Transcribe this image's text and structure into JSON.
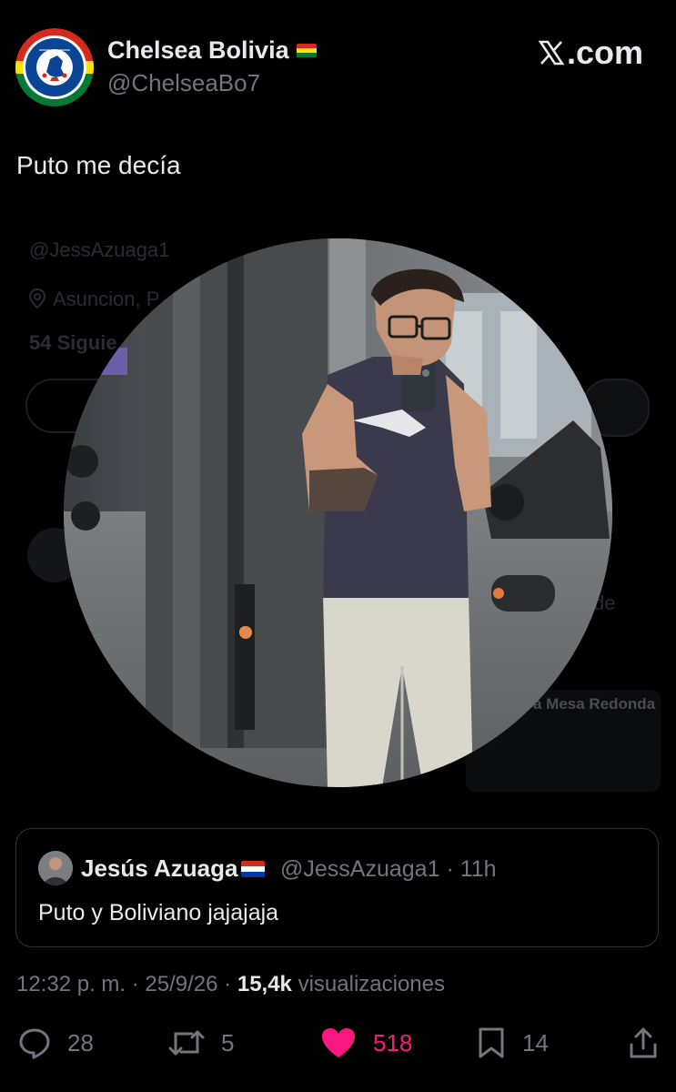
{
  "author": {
    "name": "Chelsea Bolivia",
    "handle": "@ChelseaBo7",
    "avatar_icon": "chelsea-fc-crest-icon",
    "flag": "bolivia-flag-icon"
  },
  "brand": {
    "site": ".com",
    "logo_icon": "x-logo-icon"
  },
  "tweet": {
    "text": "Puto me decía"
  },
  "media": {
    "background_profile_text": {
      "handle": "@JessAzuaga1",
      "location": "Asuncion, P",
      "following": "54 Siguie",
      "community": "a Mesa Redonda",
      "community_sub": "de"
    }
  },
  "quote": {
    "name": "Jesús Azuaga",
    "flag": "paraguay-flag-icon",
    "handle": "@JessAzuaga1",
    "time": "· 11h",
    "text": "Puto y Boliviano jajajaja"
  },
  "meta": {
    "time": "12:32 p. m.",
    "sep1": "·",
    "date": "25/9/26",
    "sep2": "·",
    "views": "15,4k",
    "views_label": "visualizaciones"
  },
  "actions": {
    "replies": "28",
    "reposts": "5",
    "likes": "518",
    "bookmarks": "14"
  },
  "colors": {
    "background": "#000000",
    "text": "#e7e9ea",
    "muted": "#71767b",
    "like": "#f91880",
    "border": "#2f3336"
  }
}
